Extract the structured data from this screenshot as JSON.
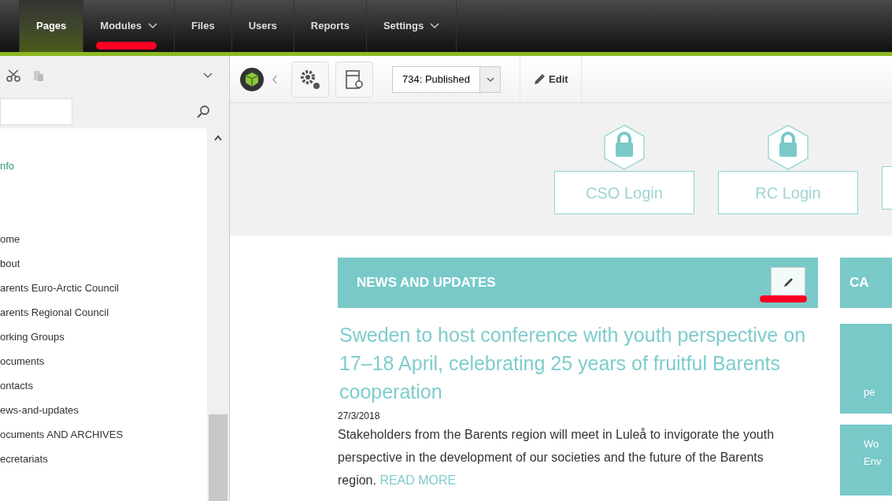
{
  "nav": [
    {
      "label": "Pages",
      "selected": true,
      "dropdown": false,
      "highlighted": false
    },
    {
      "label": "Modules",
      "selected": false,
      "dropdown": true,
      "highlighted": true
    },
    {
      "label": "Files",
      "selected": false,
      "dropdown": false,
      "highlighted": false
    },
    {
      "label": "Users",
      "selected": false,
      "dropdown": false,
      "highlighted": false
    },
    {
      "label": "Reports",
      "selected": false,
      "dropdown": false,
      "highlighted": false
    },
    {
      "label": "Settings",
      "selected": false,
      "dropdown": true,
      "highlighted": false
    }
  ],
  "sidebar": {
    "items": [
      {
        "label": "nfo",
        "kind": "link"
      },
      {
        "label": "ome",
        "kind": "page"
      },
      {
        "label": "bout",
        "kind": "page"
      },
      {
        "label": "arents Euro-Arctic Council",
        "kind": "page"
      },
      {
        "label": "arents Regional Council",
        "kind": "page"
      },
      {
        "label": "orking Groups",
        "kind": "page"
      },
      {
        "label": "ocuments",
        "kind": "page"
      },
      {
        "label": "ontacts",
        "kind": "page"
      },
      {
        "label": "ews-and-updates",
        "kind": "page"
      },
      {
        "label": "ocuments AND ARCHIVES",
        "kind": "page"
      },
      {
        "label": "ecretariats",
        "kind": "page"
      }
    ]
  },
  "toolbar": {
    "version": "734: Published",
    "edit_label": "Edit"
  },
  "logins": [
    "CSO Login",
    "RC Login"
  ],
  "news": {
    "header": "NEWS AND UPDATES",
    "edit_highlighted": true,
    "title": "Sweden to host conference with youth perspective on 17–18 April, celebrating 25 years of fruitful Barents cooperation",
    "date": "27/3/2018",
    "body": "Stakeholders from the Barents region will meet in Luleå to invigorate the youth perspective in the development of our societies and the future of the Barents region.",
    "read_more": "READ MORE"
  },
  "side_column": {
    "header": "CA",
    "tiles": [
      [
        "pe"
      ],
      [
        "Wo",
        "Env"
      ]
    ]
  }
}
